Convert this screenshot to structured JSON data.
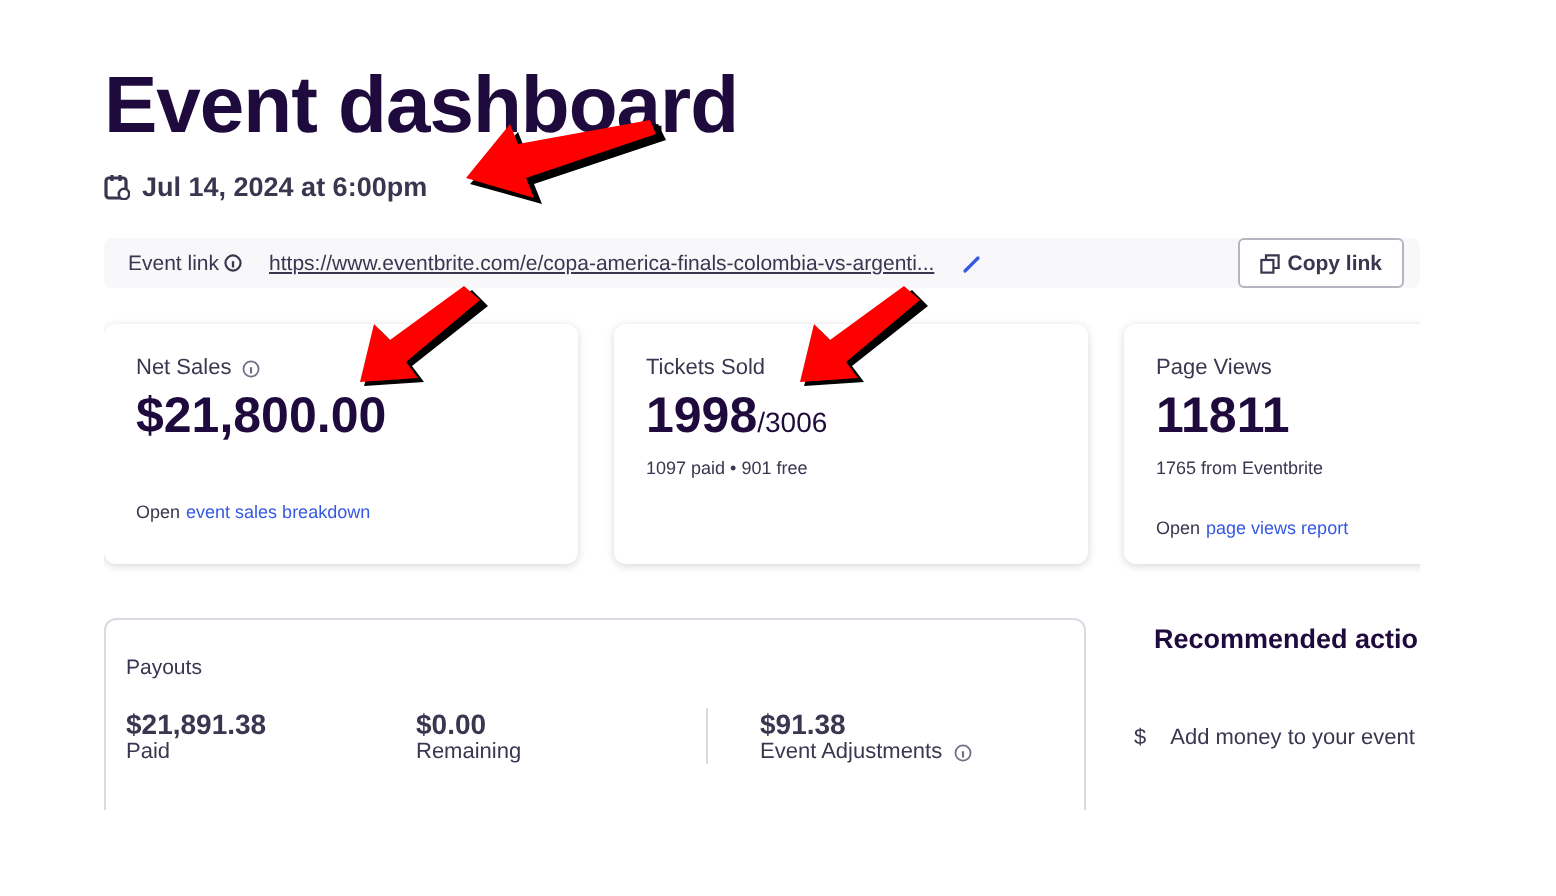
{
  "title": "Event dashboard",
  "date": "Jul 14, 2024 at 6:00pm",
  "event_link": {
    "label": "Event link",
    "url": "https://www.eventbrite.com/e/copa-america-finals-colombia-vs-argenti...",
    "button": "Copy link"
  },
  "cards": [
    {
      "title": "Net Sales",
      "info": true,
      "value": "$21,800.00",
      "link_prefix": "Open",
      "link": "event sales breakdown"
    },
    {
      "title": "Tickets Sold",
      "info": false,
      "value": "1998",
      "total": "/3006",
      "sub": "1097 paid • 901 free"
    },
    {
      "title": "Page Views",
      "info": false,
      "value": "11811",
      "sub": "1765 from Eventbrite",
      "link_prefix": "Open",
      "link": "page views report"
    }
  ],
  "payouts": {
    "title": "Payouts",
    "items": [
      {
        "amount": "$21,891.38",
        "label": "Paid",
        "info": false
      },
      {
        "amount": "$0.00",
        "label": "Remaining",
        "info": false
      },
      {
        "amount": "$91.38",
        "label": "Event Adjustments",
        "info": true
      }
    ]
  },
  "recommended": {
    "title": "Recommended actio",
    "items": [
      {
        "icon": "$",
        "text": "Add money to your event"
      }
    ]
  }
}
